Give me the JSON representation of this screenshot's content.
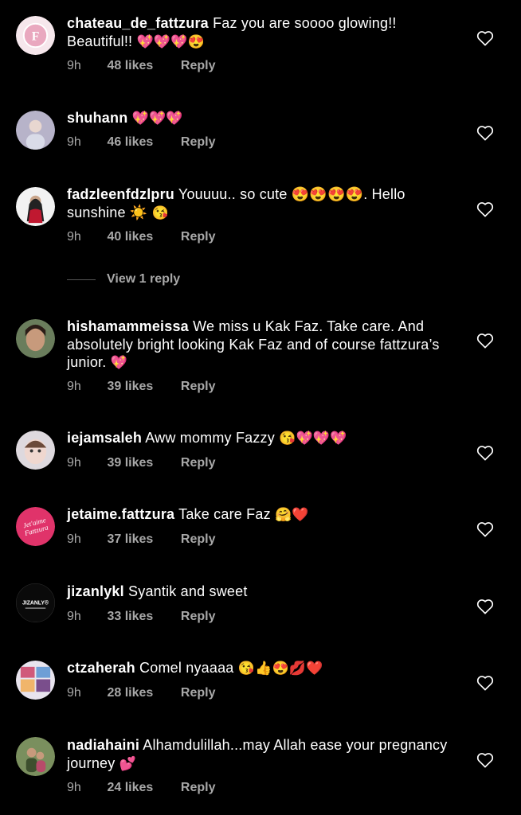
{
  "comments": [
    {
      "user": "chateau_de_fattzura",
      "text": "Faz you are soooo glowing!! Beautiful!!",
      "emoji": "💖💖💖😍",
      "time": "9h",
      "likes": "48 likes",
      "reply": "Reply"
    },
    {
      "user": "shuhann",
      "text": "",
      "emoji": "💖💖💖",
      "time": "9h",
      "likes": "46 likes",
      "reply": "Reply"
    },
    {
      "user": "fadzleenfdzlpru",
      "text": "Youuuu.. so cute 😍😍😍😍. Hello sunshine ☀️",
      "emoji": "😘",
      "time": "9h",
      "likes": "40 likes",
      "reply": "Reply"
    },
    {
      "user": "hishamammeissa",
      "text": "We miss u Kak Faz. Take care. And absolutely bright looking Kak Faz and of course fattzura’s junior.",
      "emoji": "💖",
      "time": "9h",
      "likes": "39 likes",
      "reply": "Reply"
    },
    {
      "user": "iejamsaleh",
      "text": "Aww mommy Fazzy",
      "emoji": "😘💖💖💖",
      "time": "9h",
      "likes": "39 likes",
      "reply": "Reply"
    },
    {
      "user": "jetaime.fattzura",
      "text": "Take care Faz",
      "emoji": "🤗❤️",
      "time": "9h",
      "likes": "37 likes",
      "reply": "Reply"
    },
    {
      "user": "jizanlykl",
      "text": "Syantik and sweet",
      "emoji": "",
      "time": "9h",
      "likes": "33 likes",
      "reply": "Reply"
    },
    {
      "user": "ctzaherah",
      "text": "Comel nyaaaa",
      "emoji": "😘👍😍💋❤️",
      "time": "9h",
      "likes": "28 likes",
      "reply": "Reply"
    },
    {
      "user": "nadiahaini",
      "text": "Alhamdulillah...may Allah ease your pregnancy journey",
      "emoji": "💕",
      "time": "9h",
      "likes": "24 likes",
      "reply": "Reply"
    }
  ],
  "view_reply": "View 1 reply",
  "avatar_text": {
    "c0": "F",
    "c5a": "Jet'aime",
    "c5b": "Fattzura",
    "c6": "JIZANLY®"
  }
}
